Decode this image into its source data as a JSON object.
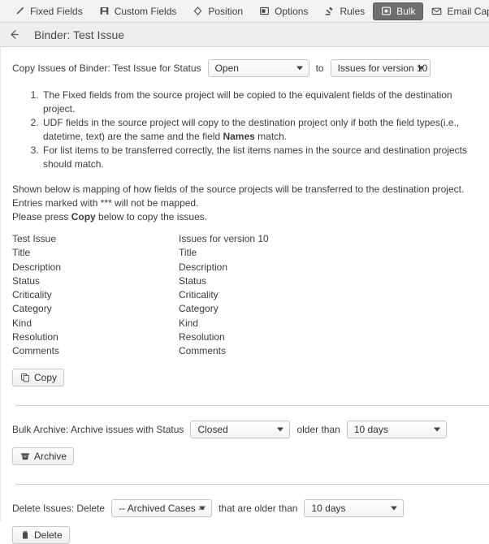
{
  "tabbar": {
    "tabs": [
      {
        "label": "Fixed Fields",
        "icon": "pencil-icon",
        "selected": false
      },
      {
        "label": "Custom Fields",
        "icon": "save-disk-icon",
        "selected": false
      },
      {
        "label": "Position",
        "icon": "diamond-icon",
        "selected": false
      },
      {
        "label": "Options",
        "icon": "window-icon",
        "selected": false
      },
      {
        "label": "Rules",
        "icon": "gavel-icon",
        "selected": false
      },
      {
        "label": "Bulk",
        "icon": "bulk-box-icon",
        "selected": true
      },
      {
        "label": "Email Capture",
        "icon": "envelope-icon",
        "selected": false
      }
    ]
  },
  "header": {
    "back_icon": "back-arrow-icon",
    "title": "Binder: Test Issue"
  },
  "copy_section": {
    "label": "Copy Issues of Binder: Test Issue for Status",
    "status_select": {
      "value": "Open"
    },
    "to_label": "to",
    "destination_select": {
      "value": "Issues for version 10"
    },
    "notes": [
      "The Fixed fields from the source project will be copied to the equivalent fields of the destination project.",
      "UDF fields in the source project will copy to the destination project only if both the field types(i.e., datetime, text) are the same and the field Names match.",
      "For list items to be transferred correctly, the list items names in the source and destination projects should match."
    ],
    "notes_bold_word": "Names",
    "paragraph_1": "Shown below is mapping of how fields of the source projects will be transferred to the destination project. Entries marked with *** will not be mapped.",
    "paragraph_2_pre": "Please press ",
    "paragraph_2_bold": "Copy",
    "paragraph_2_post": " below to copy the issues.",
    "mapping": {
      "source_header": "Test Issue",
      "destination_header": "Issues for version 10",
      "rows": [
        {
          "source": "Title",
          "destination": "Title"
        },
        {
          "source": "Description",
          "destination": "Description"
        },
        {
          "source": "Status",
          "destination": "Status"
        },
        {
          "source": "Criticality",
          "destination": "Criticality"
        },
        {
          "source": "Category",
          "destination": "Category"
        },
        {
          "source": "Kind",
          "destination": "Kind"
        },
        {
          "source": "Resolution",
          "destination": "Resolution"
        },
        {
          "source": "Comments",
          "destination": "Comments"
        }
      ]
    },
    "copy_button": {
      "label": "Copy",
      "icon": "copy-icon"
    }
  },
  "archive_section": {
    "label": "Bulk Archive: Archive issues with Status",
    "status_select": {
      "value": "Closed"
    },
    "older_than_label": "older than",
    "days_select": {
      "value": "10 days"
    },
    "archive_button": {
      "label": "Archive",
      "icon": "archive-box-icon"
    }
  },
  "delete_section": {
    "label": "Delete Issues: Delete",
    "target_select": {
      "value": "-- Archived Cases --"
    },
    "older_than_label": "that are older than",
    "days_select": {
      "value": "10 days"
    },
    "delete_button": {
      "label": "Delete",
      "icon": "trash-icon"
    }
  },
  "colors": {
    "tabbar_bg": "#f2f2f2",
    "selected_tab_bg": "#6e6e6e",
    "header_bg": "#eeeeee",
    "text": "#3c3c3c",
    "border": "#c4c4c4"
  }
}
